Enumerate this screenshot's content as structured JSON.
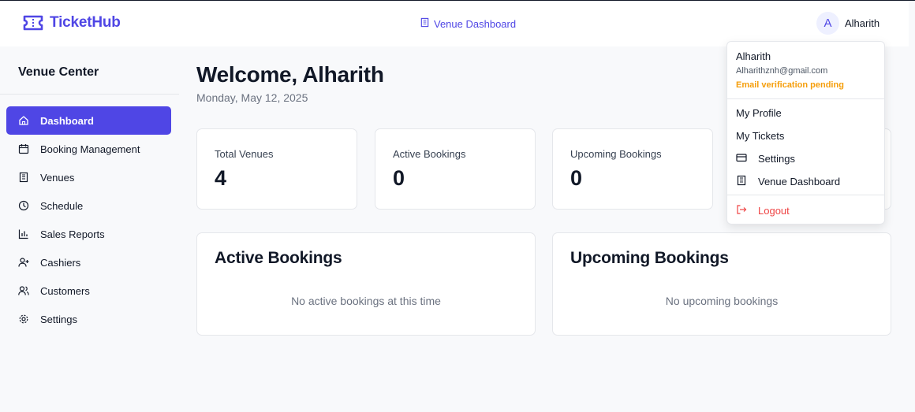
{
  "header": {
    "brand": "TicketHub",
    "venue_link": "Venue Dashboard",
    "avatar_initial": "A",
    "user_name": "Alharith"
  },
  "sidebar": {
    "title": "Venue Center",
    "items": [
      {
        "label": "Dashboard",
        "icon": "home-icon",
        "active": true
      },
      {
        "label": "Booking Management",
        "icon": "calendar-icon"
      },
      {
        "label": "Venues",
        "icon": "building-icon"
      },
      {
        "label": "Schedule",
        "icon": "clock-icon"
      },
      {
        "label": "Sales Reports",
        "icon": "bar-chart-icon"
      },
      {
        "label": "Cashiers",
        "icon": "user-plus-icon"
      },
      {
        "label": "Customers",
        "icon": "users-icon"
      },
      {
        "label": "Settings",
        "icon": "gear-icon"
      }
    ]
  },
  "main": {
    "welcome": "Welcome, Alharith",
    "date": "Monday, May 12, 2025",
    "stats": [
      {
        "label": "Total Venues",
        "value": "4"
      },
      {
        "label": "Active Bookings",
        "value": "0"
      },
      {
        "label": "Upcoming Bookings",
        "value": "0"
      }
    ],
    "panels": [
      {
        "title": "Active Bookings",
        "empty": "No active bookings at this time"
      },
      {
        "title": "Upcoming Bookings",
        "empty": "No upcoming bookings"
      }
    ]
  },
  "dropdown": {
    "name": "Alharith",
    "email": "Alharithznh@gmail.com",
    "verification": "Email verification pending",
    "items": [
      {
        "label": "My Profile"
      },
      {
        "label": "My Tickets"
      },
      {
        "label": "Settings",
        "icon": "credit-card-icon"
      },
      {
        "label": "Venue Dashboard",
        "icon": "building-icon"
      }
    ],
    "logout": "Logout"
  },
  "colors": {
    "accent": "#4f46e5",
    "warning": "#f59e0b",
    "danger": "#ef4444"
  }
}
